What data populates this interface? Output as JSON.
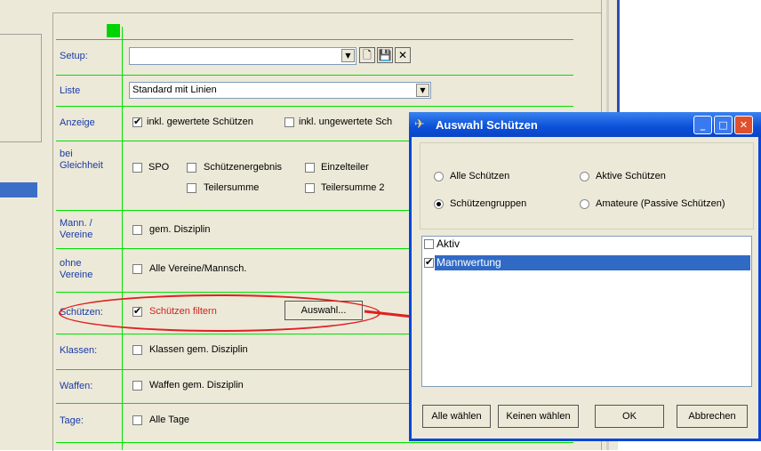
{
  "form": {
    "rows": [
      {
        "label": "Setup:"
      },
      {
        "label": "Liste"
      },
      {
        "label": "Anzeige"
      },
      {
        "label": "bei Gleichheit"
      },
      {
        "label": "Mann. / Vereine"
      },
      {
        "label": "ohne Vereine"
      },
      {
        "label": "Schützen:"
      },
      {
        "label": "Klassen:"
      },
      {
        "label": "Waffen:"
      },
      {
        "label": "Tage:"
      }
    ],
    "setup_value": "",
    "liste_value": "Standard mit Linien",
    "anzeige": {
      "opt1": "inkl. gewertete Schützen",
      "opt2": "inkl. ungewertete Sch"
    },
    "gleichheit": {
      "spo": "SPO",
      "ergebnis": "Schützenergebnis",
      "einzelteiler": "Einzelteiler",
      "teilersumme": "Teilersumme",
      "teilersumme2": "Teilersumme 2"
    },
    "mann": "gem. Disziplin",
    "ohne": "Alle Vereine/Mannsch.",
    "schuetzen": "Schützen filtern",
    "auswahl_button": "Auswahl...",
    "klassen": "Klassen gem. Disziplin",
    "waffen": "Waffen gem. Disziplin",
    "tage": "Alle Tage"
  },
  "dialog": {
    "title": "Auswahl Schützen",
    "radios": {
      "alle": "Alle Schützen",
      "aktive": "Aktive Schützen",
      "gruppen": "Schützengruppen",
      "amateure": "Amateure (Passive Schützen)"
    },
    "list": [
      {
        "label": "Aktiv",
        "checked": false
      },
      {
        "label": "Mannwertung",
        "checked": true
      }
    ],
    "buttons": {
      "alle": "Alle wählen",
      "keinen": "Keinen wählen",
      "ok": "OK",
      "abbrechen": "Abbrechen"
    }
  },
  "colors": {
    "accent": "#0a46d8",
    "highlight": "#e02020",
    "guide": "#00e000",
    "selection": "#316ac5"
  },
  "icons": [
    "dropdown-arrow-icon",
    "new-document-icon",
    "save-icon",
    "delete-icon",
    "app-icon",
    "minimize-icon",
    "maximize-icon",
    "close-icon",
    "red-arrow"
  ]
}
